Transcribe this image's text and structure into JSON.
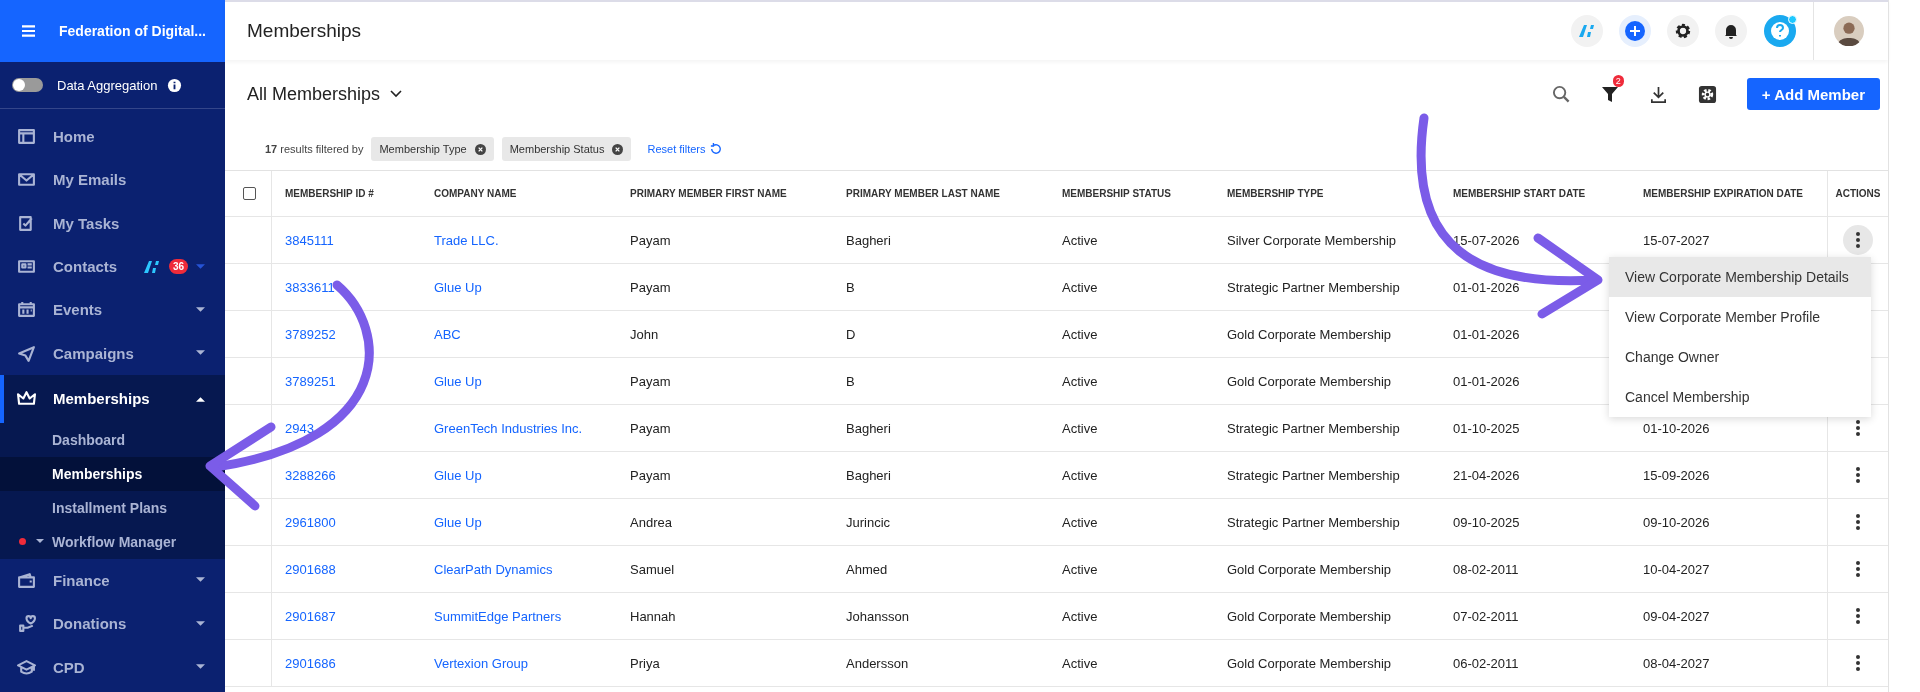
{
  "sidebar": {
    "brand": "Federation of Digital...",
    "toggle": {
      "label": "Data Aggregation",
      "on": false
    },
    "items": [
      {
        "label": "Home",
        "selected": false
      },
      {
        "label": "My Emails",
        "selected": false
      },
      {
        "label": "My Tasks",
        "selected": false
      },
      {
        "label": "Contacts",
        "selected": false,
        "expanded": false,
        "ai": true,
        "count": "36"
      },
      {
        "label": "Events",
        "selected": false,
        "expanded": false
      },
      {
        "label": "Campaigns",
        "selected": false,
        "expanded": false
      },
      {
        "label": "Memberships",
        "selected": true,
        "expanded": true,
        "children": [
          {
            "label": "Dashboard",
            "selected": false
          },
          {
            "label": "Memberships",
            "selected": true
          },
          {
            "label": "Installment Plans",
            "selected": false
          },
          {
            "label": "Workflow Manager",
            "selected": false,
            "expanded": false,
            "alert": true
          }
        ]
      },
      {
        "label": "Finance",
        "selected": false,
        "expanded": false
      },
      {
        "label": "Donations",
        "selected": false,
        "expanded": false
      },
      {
        "label": "CPD",
        "selected": false,
        "expanded": false
      }
    ]
  },
  "header": {
    "title": "Memberships",
    "help_alert": true
  },
  "toolbar": {
    "view": "All Memberships",
    "filter_count": "2",
    "add_button": "+ Add Member"
  },
  "filters": {
    "summary": "**17** results filtered by",
    "chips": [
      "Membership Type",
      "Membership Status"
    ],
    "reset": "Reset filters"
  },
  "table": {
    "columns": [
      "MEMBERSHIP ID #",
      "COMPANY NAME",
      "PRIMARY MEMBER FIRST NAME",
      "PRIMARY MEMBER LAST NAME",
      "MEMBERSHIP STATUS",
      "MEMBERSHIP TYPE",
      "MEMBERSHIP START DATE",
      "MEMBERSHIP EXPIRATION DATE",
      "ACTIONS"
    ],
    "select_all": false,
    "rows": [
      {
        "id": "3845111",
        "company": "Trade LLC.",
        "first": "Payam",
        "last": "Bagheri",
        "status": "Active",
        "type": "Silver Corporate Membership",
        "start": "15-07-2026",
        "end": "15-07-2027",
        "menu_open": true
      },
      {
        "id": "3833611",
        "company": "Glue Up",
        "first": "Payam",
        "last": "B",
        "status": "Active",
        "type": "Strategic Partner Membership",
        "start": "01-01-2026"
      },
      {
        "id": "3789252",
        "company": "ABC",
        "first": "John",
        "last": "D",
        "status": "Active",
        "type": "Gold Corporate Membership",
        "start": "01-01-2026"
      },
      {
        "id": "3789251",
        "company": "Glue Up",
        "first": "Payam",
        "last": "B",
        "status": "Active",
        "type": "Gold Corporate Membership",
        "start": "01-01-2026"
      },
      {
        "id": "2943",
        "company": "GreenTech Industries Inc.",
        "first": "Payam",
        "last": "Bagheri",
        "status": "Active",
        "type": "Strategic Partner Membership",
        "start": "01-10-2025",
        "end": "01-10-2026",
        "menu_open": false
      },
      {
        "id": "3288266",
        "company": "Glue Up",
        "first": "Payam",
        "last": "Bagheri",
        "status": "Active",
        "type": "Strategic Partner Membership",
        "start": "21-04-2026",
        "end": "15-09-2026",
        "menu_open": false
      },
      {
        "id": "2961800",
        "company": "Glue Up",
        "first": "Andrea",
        "last": "Jurincic",
        "status": "Active",
        "type": "Strategic Partner Membership",
        "start": "09-10-2025",
        "end": "09-10-2026",
        "menu_open": false
      },
      {
        "id": "2901688",
        "company": "ClearPath Dynamics",
        "first": "Samuel",
        "last": "Ahmed",
        "status": "Active",
        "type": "Gold Corporate Membership",
        "start": "08-02-2011",
        "end": "10-04-2027",
        "menu_open": false
      },
      {
        "id": "2901687",
        "company": "SummitEdge Partners",
        "first": "Hannah",
        "last": "Johansson",
        "status": "Active",
        "type": "Gold Corporate Membership",
        "start": "07-02-2011",
        "end": "09-04-2027",
        "menu_open": false
      },
      {
        "id": "2901686",
        "company": "Vertexion Group",
        "first": "Priya",
        "last": "Andersson",
        "status": "Active",
        "type": "Gold Corporate Membership",
        "start": "06-02-2011",
        "end": "08-04-2027",
        "menu_open": false
      }
    ]
  },
  "action_menu": [
    {
      "label": "View Corporate Membership Details",
      "selected": true
    },
    {
      "label": "View Corporate Member Profile",
      "selected": false
    },
    {
      "label": "Change Owner",
      "selected": false
    },
    {
      "label": "Cancel Membership",
      "selected": false
    }
  ]
}
